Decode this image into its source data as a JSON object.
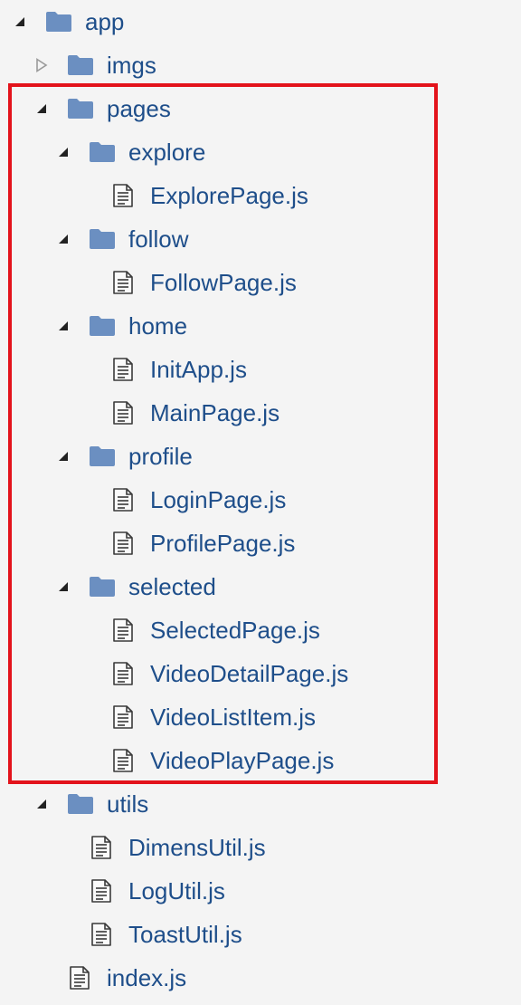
{
  "tree": [
    {
      "label": "app",
      "type": "folder",
      "depth": 0,
      "expanded": true
    },
    {
      "label": "imgs",
      "type": "folder",
      "depth": 1,
      "expanded": false
    },
    {
      "label": "pages",
      "type": "folder",
      "depth": 1,
      "expanded": true
    },
    {
      "label": "explore",
      "type": "folder",
      "depth": 2,
      "expanded": true
    },
    {
      "label": "ExplorePage.js",
      "type": "file",
      "depth": 3
    },
    {
      "label": "follow",
      "type": "folder",
      "depth": 2,
      "expanded": true
    },
    {
      "label": "FollowPage.js",
      "type": "file",
      "depth": 3
    },
    {
      "label": "home",
      "type": "folder",
      "depth": 2,
      "expanded": true
    },
    {
      "label": "InitApp.js",
      "type": "file",
      "depth": 3
    },
    {
      "label": "MainPage.js",
      "type": "file",
      "depth": 3
    },
    {
      "label": "profile",
      "type": "folder",
      "depth": 2,
      "expanded": true
    },
    {
      "label": "LoginPage.js",
      "type": "file",
      "depth": 3
    },
    {
      "label": "ProfilePage.js",
      "type": "file",
      "depth": 3
    },
    {
      "label": "selected",
      "type": "folder",
      "depth": 2,
      "expanded": true
    },
    {
      "label": "SelectedPage.js",
      "type": "file",
      "depth": 3
    },
    {
      "label": "VideoDetailPage.js",
      "type": "file",
      "depth": 3
    },
    {
      "label": "VideoListItem.js",
      "type": "file",
      "depth": 3
    },
    {
      "label": "VideoPlayPage.js",
      "type": "file",
      "depth": 3
    },
    {
      "label": "utils",
      "type": "folder",
      "depth": 1,
      "expanded": true
    },
    {
      "label": "DimensUtil.js",
      "type": "file",
      "depth": 2
    },
    {
      "label": "LogUtil.js",
      "type": "file",
      "depth": 2
    },
    {
      "label": "ToastUtil.js",
      "type": "file",
      "depth": 2
    },
    {
      "label": "index.js",
      "type": "file",
      "depth": 1
    }
  ],
  "colors": {
    "background": "#f4f4f4",
    "label": "#1e4e8a",
    "folder": "#6b8fc1",
    "twisty": "#222222",
    "twisty_collapsed": "#9a9a9a",
    "file_icon": "#3a3a3a",
    "highlight": "#e3131b"
  },
  "highlight": {
    "label": "annotation-highlight-box"
  }
}
